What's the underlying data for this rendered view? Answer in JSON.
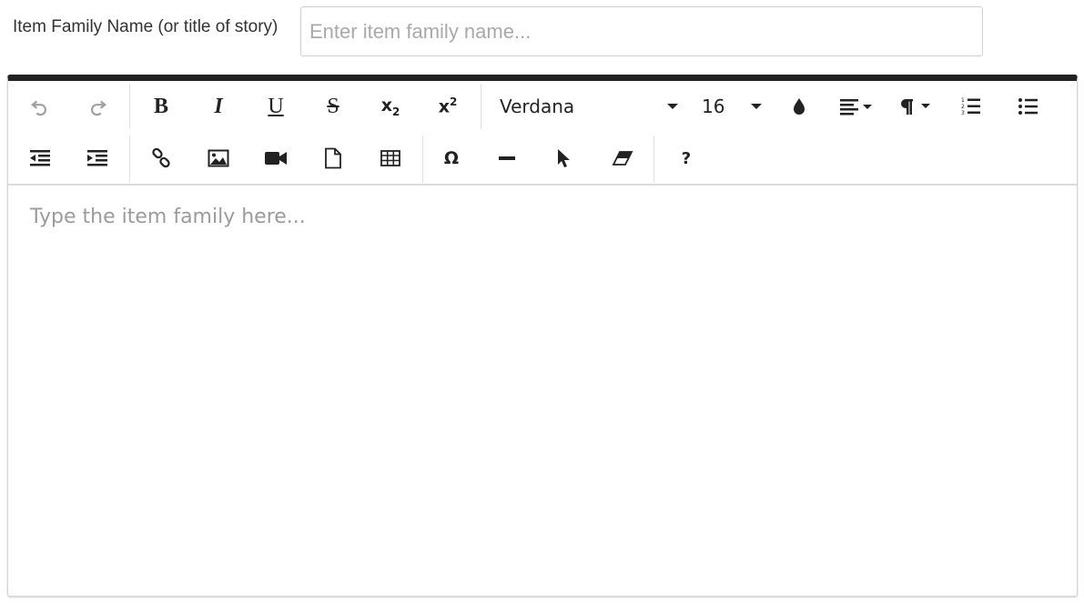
{
  "form": {
    "label": "Item Family Name (or title of story)",
    "placeholder": "Enter item family name...",
    "value": ""
  },
  "toolbar": {
    "font_name": "Verdana",
    "font_size": "16",
    "subscript_label": "x",
    "subscript_sub": "2",
    "superscript_label": "x",
    "superscript_sup": "2",
    "special_char_label": "Ω",
    "help_label": "?"
  },
  "editor": {
    "placeholder": "Type the item family here...",
    "accent_color": "#222222"
  }
}
